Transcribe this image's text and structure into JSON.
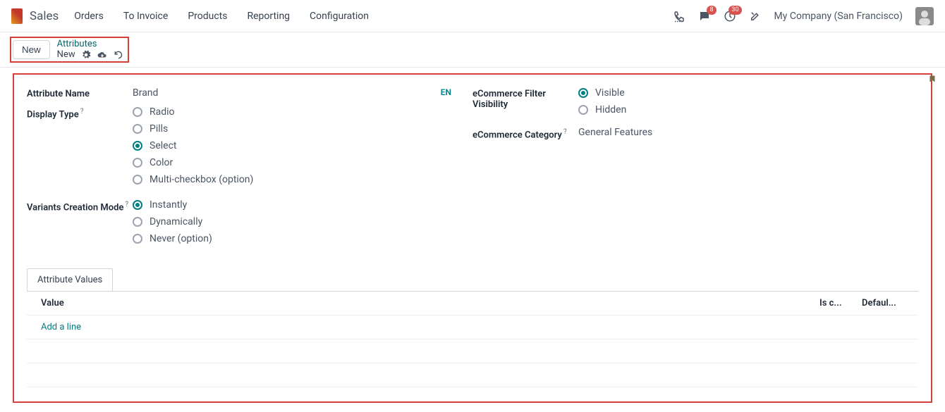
{
  "nav": {
    "app_name": "Sales",
    "menu": [
      "Orders",
      "To Invoice",
      "Products",
      "Reporting",
      "Configuration"
    ],
    "company": "My Company (San Francisco)",
    "messaging_badge": "8",
    "activity_badge": "30"
  },
  "control": {
    "new_btn": "New",
    "breadcrumb_parent": "Attributes",
    "breadcrumb_current": "New"
  },
  "form": {
    "attribute_name_label": "Attribute Name",
    "attribute_name_value": "Brand",
    "lang_badge": "EN",
    "display_type_label": "Display Type",
    "display_type_options": {
      "radio": "Radio",
      "pills": "Pills",
      "select": "Select",
      "color": "Color",
      "multi": "Multi-checkbox (option)"
    },
    "display_type_selected": "select",
    "vcm_label": "Variants Creation Mode",
    "vcm_options": {
      "instantly": "Instantly",
      "dynamically": "Dynamically",
      "never": "Never (option)"
    },
    "vcm_selected": "instantly",
    "efv_label": "eCommerce Filter Visibility",
    "efv_options": {
      "visible": "Visible",
      "hidden": "Hidden"
    },
    "efv_selected": "visible",
    "ecat_label": "eCommerce Category",
    "ecat_value": "General Features"
  },
  "tabs": {
    "attribute_values": "Attribute Values"
  },
  "table": {
    "col_value": "Value",
    "col_is": "Is c...",
    "col_def": "Defaul...",
    "add_line": "Add a line"
  },
  "icons": {
    "gear": "gear",
    "cloud": "cloud",
    "undo": "undo",
    "phone": "phone",
    "chat": "chat",
    "clock": "clock",
    "tools": "tools",
    "bookmark": "bookmark"
  }
}
